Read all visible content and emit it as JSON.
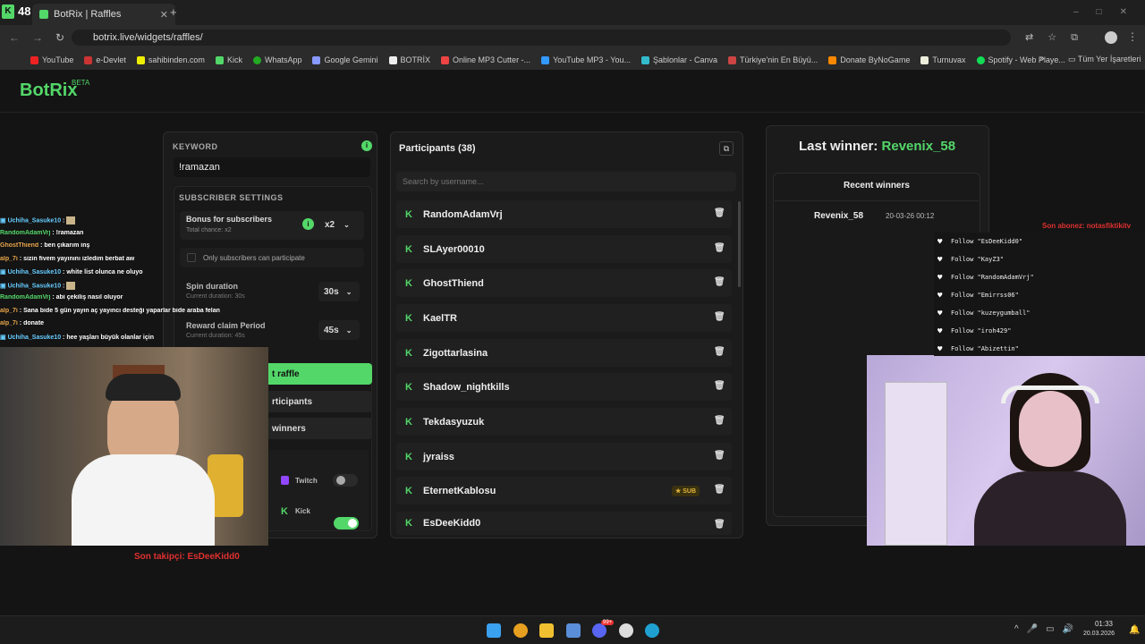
{
  "browser": {
    "tab_count_badge": "48",
    "tab_title": "BotRix | Raffles",
    "new_tab_label": "+",
    "url": "botrix.live/widgets/raffles/",
    "bookmarks": [
      "YouTube",
      "e-Devlet",
      "sahibinden.com",
      "Kick",
      "WhatsApp",
      "Google Gemini",
      "BOTRİX",
      "Online MP3 Cutter -...",
      "YouTube MP3 - You...",
      "Şablonlar - Canva",
      "Türkiye'nin En Büyü...",
      "Donate ByNoGame",
      "Turnuvax",
      "Spotify - Web Playe..."
    ],
    "bookmarks_folder": "Tüm Yer İşaretleri"
  },
  "app": {
    "logo": "BotRix",
    "logo_beta": "BETA",
    "keyword_label": "KEYWORD",
    "keyword_value": "!ramazan",
    "subscriber_settings_label": "SUBSCRIBER SETTINGS",
    "bonus_label": "Bonus for subscribers",
    "bonus_sub": "Total chance: x2",
    "bonus_value": "x2",
    "only_subs_label": "Only subscribers can participate",
    "spin_label": "Spin duration",
    "spin_sub": "Current duration: 30s",
    "spin_value": "30s",
    "claim_label": "Reward claim Period",
    "claim_sub": "Current duration: 45s",
    "claim_value": "45s",
    "start_raffle_fragment": "t raffle",
    "participants_btn_fragment": "rticipants",
    "winners_btn_fragment": "winners",
    "twitch_label": "Twitch",
    "kick_label": "Kick",
    "participants_title": "Participants (38)",
    "search_placeholder": "Search by username...",
    "participants": [
      {
        "name": "RandomAdamVrj",
        "sub": ""
      },
      {
        "name": "SLAyer00010",
        "sub": ""
      },
      {
        "name": "GhostThiend",
        "sub": ""
      },
      {
        "name": "KaelTR",
        "sub": ""
      },
      {
        "name": "Zigottarlasina",
        "sub": ""
      },
      {
        "name": "Shadow_nightkills",
        "sub": ""
      },
      {
        "name": "Tekdasyuzuk",
        "sub": ""
      },
      {
        "name": "jyraiss",
        "sub": ""
      },
      {
        "name": "EternetKablosu",
        "sub": "SUB"
      },
      {
        "name": "EsDeeKidd0",
        "sub": ""
      }
    ],
    "last_winner_label": "Last winner:",
    "last_winner_name": "Revenix_58",
    "recent_winners_title": "Recent winners",
    "recent_winner_name": "Revenix_58",
    "recent_winner_time": "20-03-26 00:12"
  },
  "overlay": {
    "chat": [
      {
        "user": "Uchiha_Sasuke10",
        "msg": "",
        "color": "#6cf"
      },
      {
        "user": "RandomAdamVrj",
        "msg": "!ramazan",
        "color": "#53d769"
      },
      {
        "user": "GhostThiend",
        "msg": "ben çıkarım inş",
        "color": "#e8a54a"
      },
      {
        "user": "alp_7i",
        "msg": "sizin fivem yayınını izledim berbat aw",
        "color": "#e8a54a"
      },
      {
        "user": "Uchiha_Sasuke10",
        "msg": "white list olunca ne oluyo",
        "color": "#6cf"
      },
      {
        "user": "Uchiha_Sasuke10",
        "msg": "",
        "color": "#6cf"
      },
      {
        "user": "RandomAdamVrj",
        "msg": "abi çekiliş nasıl oluyor",
        "color": "#53d769"
      },
      {
        "user": "alp_7i",
        "msg": "Sana bide 5 gün yayın aç yayıncı desteği yaparlar bide araba felan",
        "color": "#e8a54a"
      },
      {
        "user": "alp_7i",
        "msg": "donate",
        "color": "#e8a54a"
      },
      {
        "user": "Uchiha_Sasuke10",
        "msg": "hee yaşları büyük olanlar için",
        "color": "#6cf"
      }
    ],
    "last_follower": "Son takipçi: EsDeeKidd0",
    "last_donor": "Son abonez: notasfiktikitv",
    "follows": [
      "Follow \"EsDeeKidd0\"",
      "Follow \"KayZ3\"",
      "Follow \"RandomAdamVrj\"",
      "Follow \"Emirrss06\"",
      "Follow \"kuzeygumball\"",
      "Follow \"iroh429\"",
      "Follow \"Abizettin\""
    ]
  },
  "taskbar": {
    "time": "01:33",
    "date": "20.03.2026",
    "notif_badge": "99+"
  },
  "colors": {
    "accent": "#53d769",
    "bg": "#141414",
    "panel": "#1b1b1b",
    "red_overlay": "#e03030"
  }
}
